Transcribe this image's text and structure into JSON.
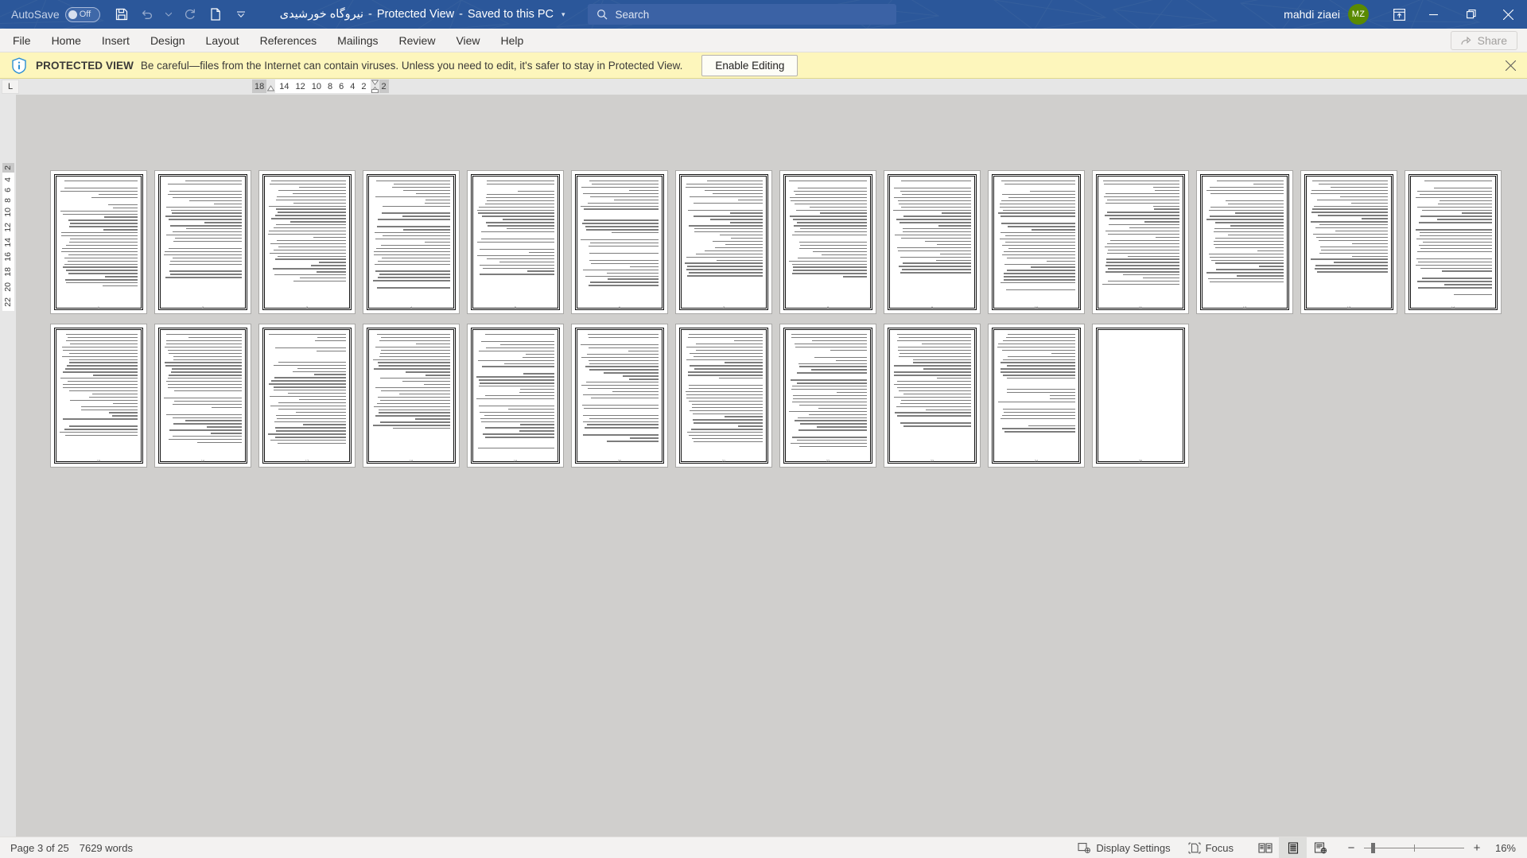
{
  "titlebar": {
    "autosave_label": "AutoSave",
    "autosave_state": "Off",
    "save_icon": "save-icon",
    "undo_icon": "undo-icon",
    "redo_icon": "redo-icon",
    "newdoc_icon": "new-document-icon",
    "customize_icon": "customize-quick-access-toolbar-icon",
    "doc_name": "نیروگاه خورشیدی",
    "sep1": "-",
    "protected_view": "Protected View",
    "sep2": "-",
    "save_location": "Saved to this PC",
    "title_caret": "▾",
    "search_placeholder": "Search",
    "search_icon": "search-icon",
    "user_name": "mahdi ziaei",
    "user_initials": "MZ",
    "avatar_color": "#5a8a00",
    "ribbon_display_icon": "ribbon-display-options-icon",
    "minimize": "minimize-icon",
    "restore": "restore-icon",
    "close": "close-icon",
    "bg_color": "#2b579a"
  },
  "ribbon": {
    "tabs": [
      {
        "label": "File"
      },
      {
        "label": "Home"
      },
      {
        "label": "Insert"
      },
      {
        "label": "Design"
      },
      {
        "label": "Layout"
      },
      {
        "label": "References"
      },
      {
        "label": "Mailings"
      },
      {
        "label": "Review"
      },
      {
        "label": "View"
      },
      {
        "label": "Help"
      }
    ],
    "share_label": "Share",
    "share_icon": "share-icon"
  },
  "protected_view": {
    "icon": "info-shield-icon",
    "title": "PROTECTED VIEW",
    "message": "Be careful—files from the Internet can contain viruses. Unless you need to edit, it's safer to stay in Protected View.",
    "button_label": "Enable Editing",
    "close_icon": "close-icon",
    "bg_color": "#fdf6bc"
  },
  "ruler": {
    "tab_stop_marker": "L",
    "horizontal_left_label": "18",
    "horizontal_numbers": [
      "14",
      "12",
      "10",
      "8",
      "6",
      "4",
      "2"
    ],
    "horizontal_right_label": "2",
    "vertical_top_label": "2",
    "vertical_numbers": [
      "4",
      "6",
      "8",
      "10",
      "12",
      "14",
      "16",
      "18",
      "20",
      "22"
    ]
  },
  "document": {
    "zoom_percent": "16%",
    "page_count": 25,
    "pages": [
      {
        "number": "1",
        "blank": false
      },
      {
        "number": "2",
        "blank": false
      },
      {
        "number": "3",
        "blank": false
      },
      {
        "number": "4",
        "blank": false
      },
      {
        "number": "5",
        "blank": false
      },
      {
        "number": "6",
        "blank": false
      },
      {
        "number": "7",
        "blank": false
      },
      {
        "number": "8",
        "blank": false
      },
      {
        "number": "9",
        "blank": false
      },
      {
        "number": "10",
        "blank": false
      },
      {
        "number": "11",
        "blank": false
      },
      {
        "number": "12",
        "blank": false
      },
      {
        "number": "13",
        "blank": false
      },
      {
        "number": "14",
        "blank": false
      },
      {
        "number": "15",
        "blank": false
      },
      {
        "number": "16",
        "blank": false
      },
      {
        "number": "17",
        "blank": false
      },
      {
        "number": "18",
        "blank": false
      },
      {
        "number": "19",
        "blank": false
      },
      {
        "number": "20",
        "blank": false
      },
      {
        "number": "21",
        "blank": false
      },
      {
        "number": "22",
        "blank": false
      },
      {
        "number": "23",
        "blank": false
      },
      {
        "number": "24",
        "blank": false
      },
      {
        "number": "25",
        "blank": true
      }
    ]
  },
  "statusbar": {
    "page_status": "Page 3 of 25",
    "word_count": "7629 words",
    "display_settings_label": "Display Settings",
    "display_settings_icon": "display-settings-icon",
    "focus_label": "Focus",
    "focus_icon": "focus-mode-icon",
    "view_read_icon": "read-mode-icon",
    "view_print_icon": "print-layout-icon",
    "view_web_icon": "web-layout-icon",
    "zoom_out": "−",
    "zoom_in": "+",
    "zoom_level": "16%"
  }
}
